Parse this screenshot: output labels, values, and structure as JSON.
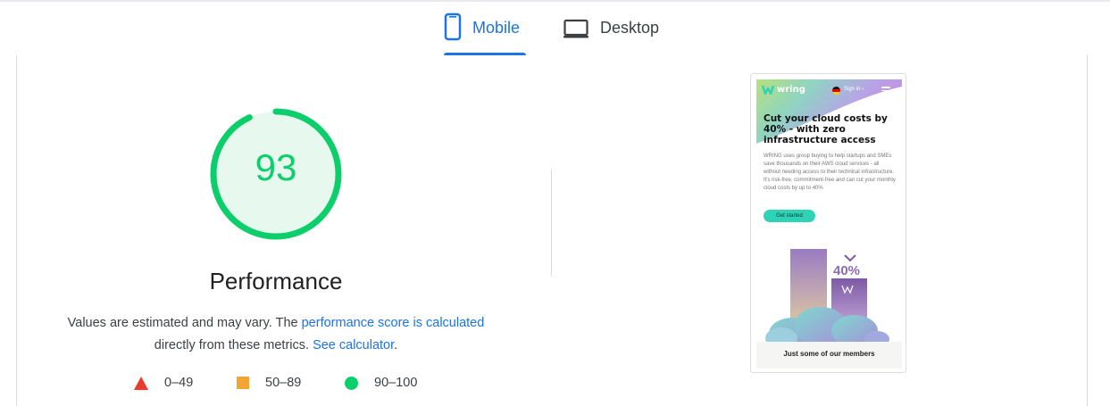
{
  "tabs": [
    {
      "label": "Mobile",
      "icon": "mobile-phone-icon",
      "selected": true
    },
    {
      "label": "Desktop",
      "icon": "desktop-monitor-icon",
      "selected": false
    }
  ],
  "performance": {
    "score": "93",
    "title": "Performance",
    "description_prefix": "Values are estimated and may vary. The ",
    "score_link": "performance score is calculated",
    "description_middle": " directly from these metrics. ",
    "calculator_link": "See calculator",
    "description_suffix": "."
  },
  "legend": [
    {
      "label": "0–49",
      "symbol": "triangle",
      "color": "#eb3a2e"
    },
    {
      "label": "50–89",
      "symbol": "square",
      "color": "#f2a532"
    },
    {
      "label": "90–100",
      "symbol": "circle",
      "color": "#0cce6b"
    }
  ],
  "screenshot": {
    "logo": "wring",
    "signin": "Sign in ›",
    "hero_title": "Cut your cloud costs by 40% - with zero infrastructure access",
    "hero_body": "WRING uses group buying to help startups and SMEs save thousands on their AWS cloud services - all without needing access to their technical infrastructure. It's risk-free, commitment-free and can cut your monthly cloud costs by up to 40%",
    "cta": "Get started",
    "percent": "40%",
    "members": "Just some of our members"
  },
  "colors": {
    "accent": "#1a73e8",
    "pass": "#0cce6b",
    "average": "#f2a532",
    "fail": "#eb3a2e"
  }
}
